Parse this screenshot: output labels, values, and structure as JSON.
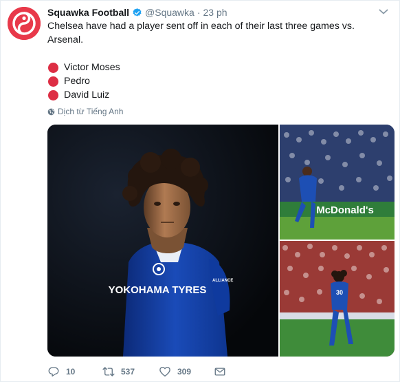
{
  "tweet": {
    "author_name": "Squawka Football",
    "author_handle": "@Squawka",
    "separator": "·",
    "time": "23 ph",
    "text_lines": [
      "Chelsea have had a player sent off in each of their last three games vs.",
      "Arsenal."
    ],
    "players": [
      "Victor Moses",
      "Pedro",
      "David Luiz"
    ],
    "translate_label": "Dịch từ Tiếng Anh",
    "images": {
      "main_shirt_sponsor": "YOKOHAMA TYRES",
      "main_sleeve_sponsor": "ALLIANCE",
      "top_right_board": "McDonald's",
      "bottom_right_shirt_number": "30"
    }
  },
  "actions": {
    "reply_count": "10",
    "retweet_count": "537",
    "like_count": "309"
  },
  "colors": {
    "brand": "#e8394a",
    "verified": "#1da1f2",
    "bullet": "#dd2e44",
    "muted": "#657786"
  },
  "icons": {
    "avatar": "squawka-logo",
    "verified": "verified-badge-icon",
    "menu": "chevron-down-icon",
    "translate": "globe-icon",
    "reply": "reply-icon",
    "retweet": "retweet-icon",
    "like": "heart-icon",
    "dm": "envelope-icon"
  }
}
